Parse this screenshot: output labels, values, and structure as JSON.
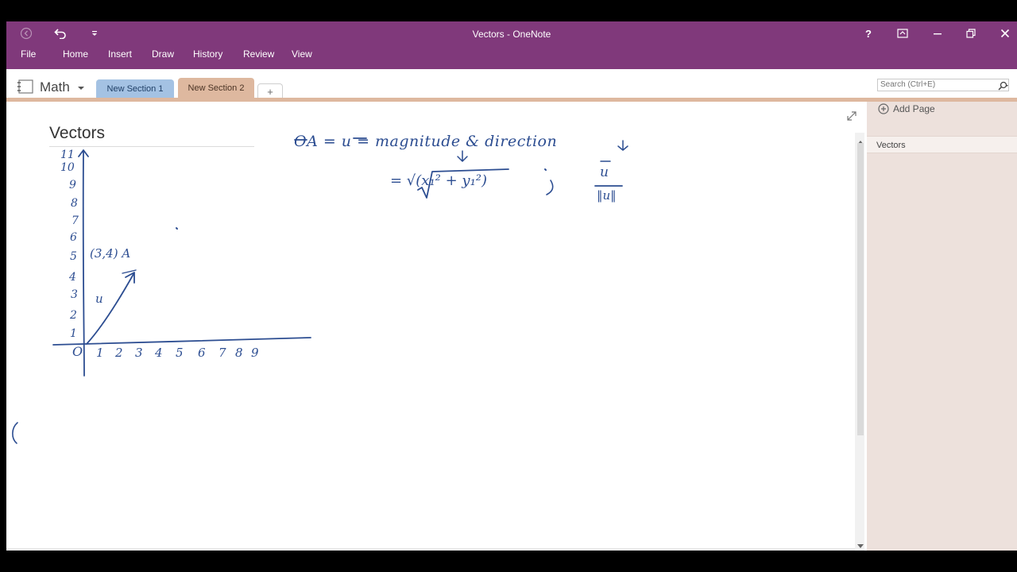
{
  "window": {
    "title": "Vectors - OneNote"
  },
  "ribbon": {
    "tabs": [
      "File",
      "Home",
      "Insert",
      "Draw",
      "History",
      "Review",
      "View"
    ]
  },
  "titlebar_buttons": {
    "help": "?"
  },
  "notebook": {
    "name": "Math"
  },
  "sections": [
    {
      "label": "New Section 1",
      "color": "#a4c2e3",
      "active": false
    },
    {
      "label": "New Section 2",
      "color": "#deb89f",
      "active": true
    }
  ],
  "add_section_label": "+",
  "search": {
    "placeholder": "Search (Ctrl+E)"
  },
  "page": {
    "title": "Vectors"
  },
  "pages_pane": {
    "add_page_label": "Add Page",
    "pages": [
      "Vectors"
    ]
  },
  "colors": {
    "titlebar": "#80397b",
    "ink": "#2c4d91",
    "section_accent": "#deb89f"
  },
  "ink_notes": {
    "y_axis_labels": [
      "1",
      "2",
      "3",
      "4",
      "5",
      "6",
      "7",
      "8",
      "9",
      "10",
      "11"
    ],
    "x_axis_labels": [
      "1",
      "2",
      "3",
      "4",
      "5",
      "6",
      "7",
      "8",
      "9"
    ],
    "origin_label": "O",
    "point_label": "(3,4) A",
    "vector_label": "u",
    "equation_lhs": "OA = u = magnitude & direction",
    "magnitude_formula": "= √(x₁² + y₁²)",
    "direction_numerator": "u",
    "direction_denominator": "‖u‖"
  }
}
